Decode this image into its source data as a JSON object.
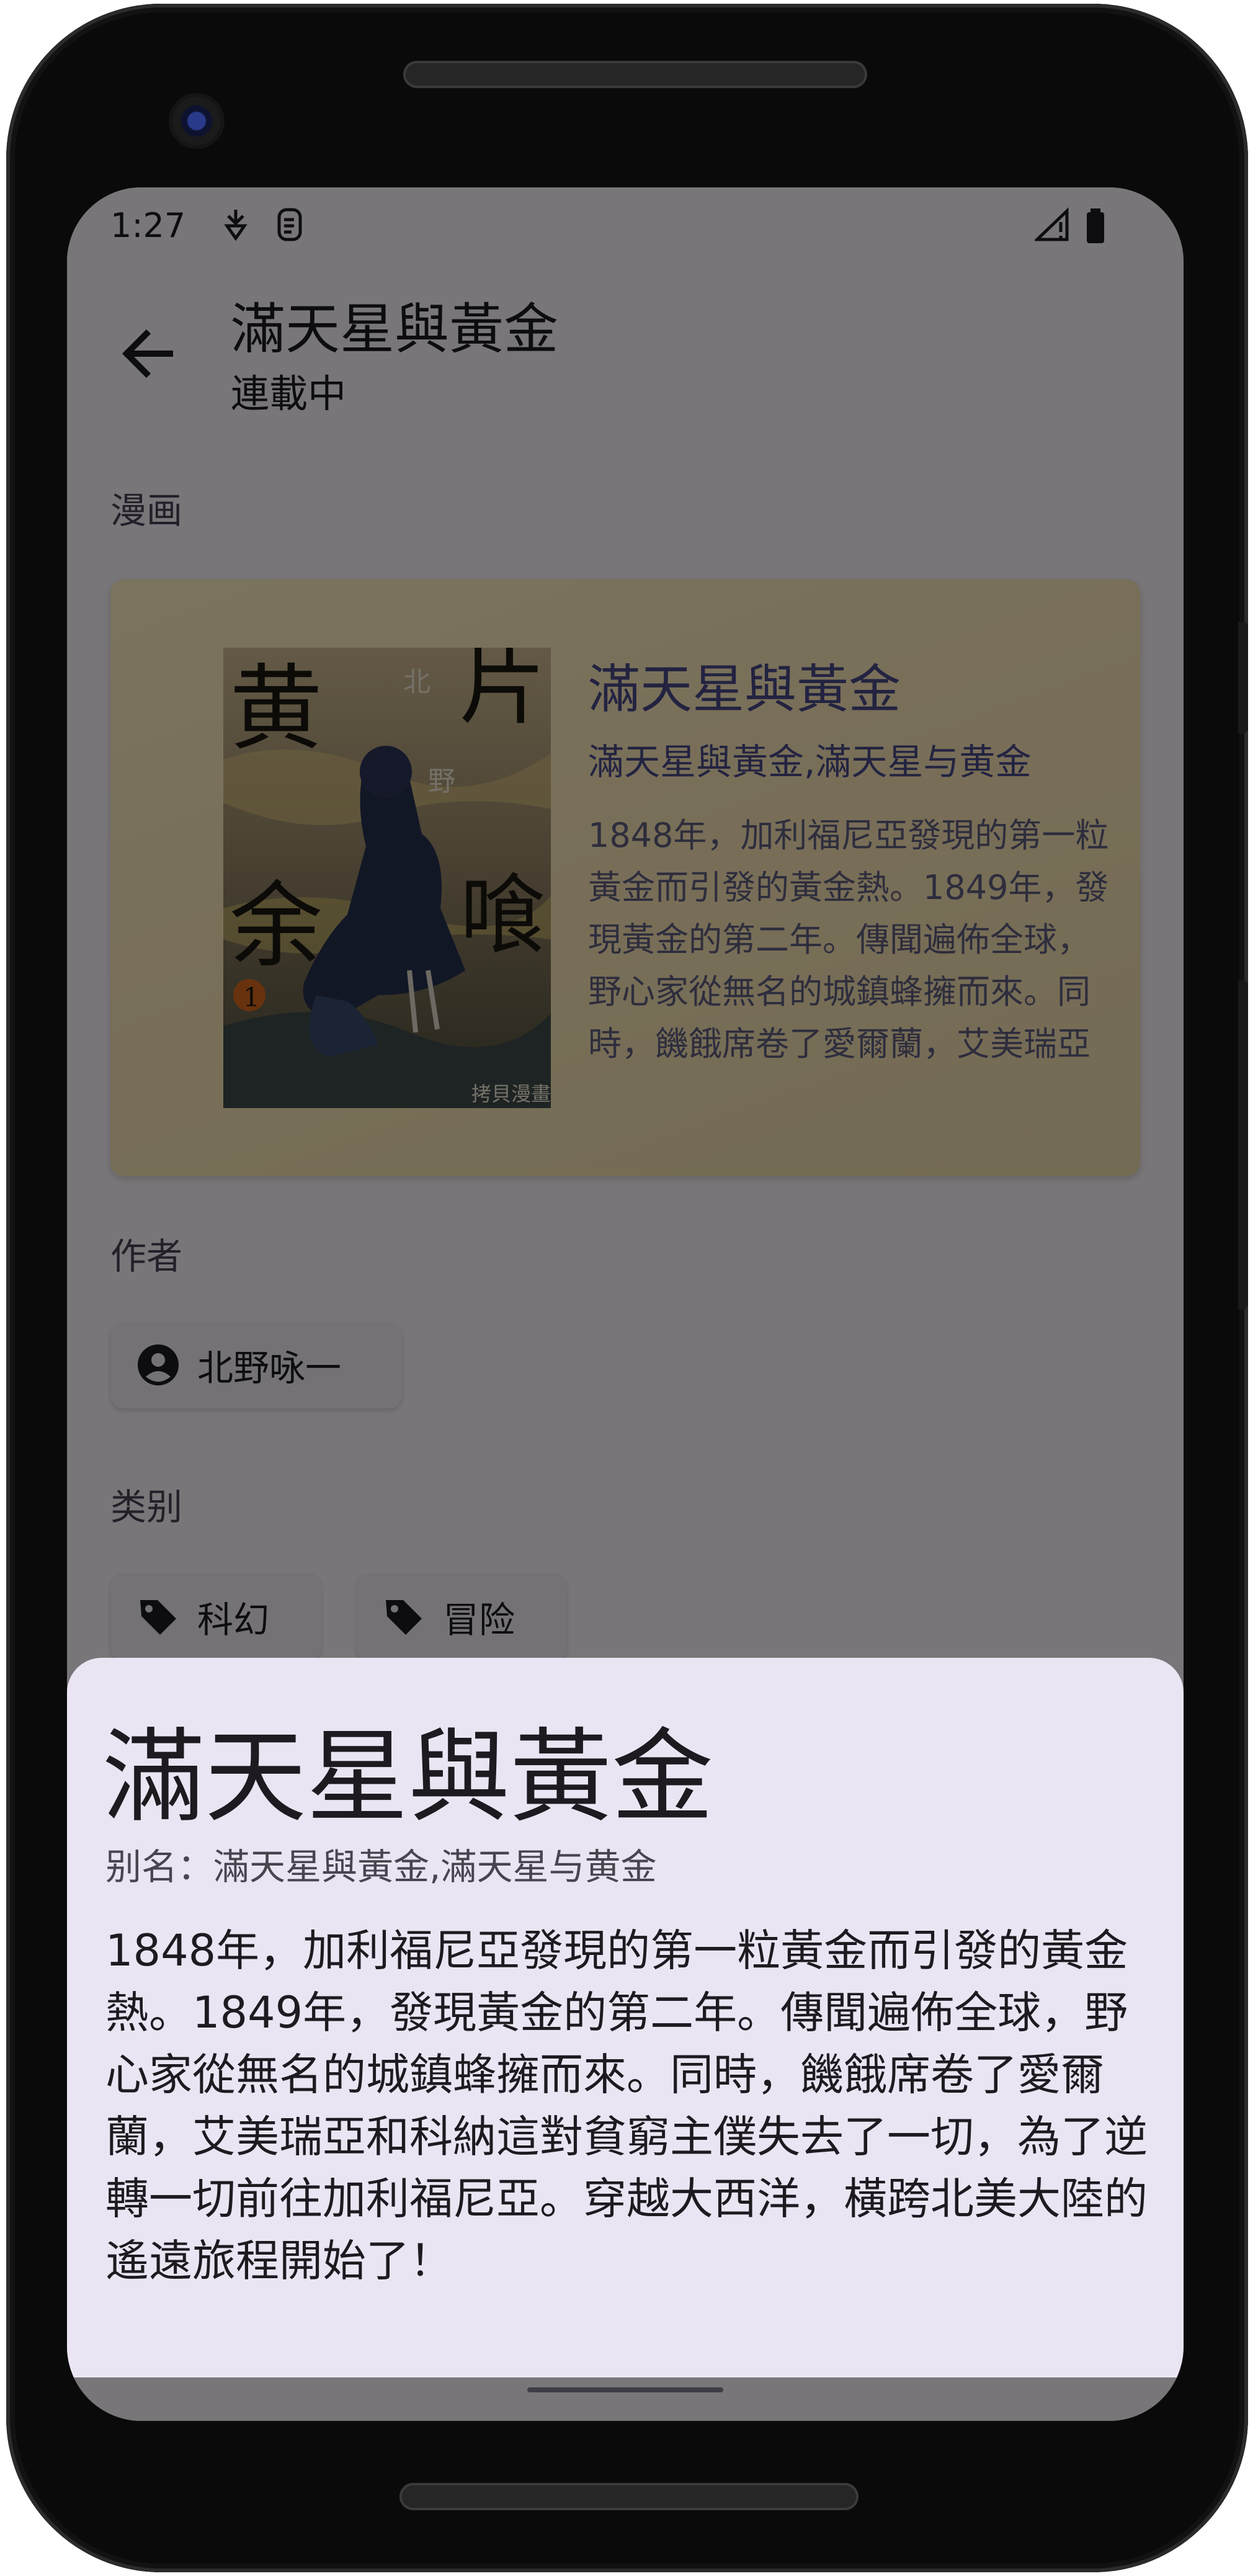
{
  "status_bar": {
    "time": "1:27"
  },
  "app_bar": {
    "title": "滿天星與黃金",
    "subtitle": "連載中"
  },
  "sections": {
    "comic_label": "漫画",
    "author_label": "作者",
    "category_label": "类别"
  },
  "card": {
    "title": "滿天星與黃金",
    "alias": "滿天星與黃金,滿天星与黄金",
    "description": "1848年，加利福尼亞發現的第一粒黃金而引發的黃金熱。1849年，發現黃金的第二年。傳聞遍佈全球，野心家從無名的城鎮蜂擁而來。同時，饑餓席卷了愛爾蘭，艾美瑞亞和科納這對貧窮主僕失去了一切，為了逆轉一切前往加利福尼亞。",
    "cover_chars": [
      "黄",
      "片",
      "余",
      "喰",
      "北",
      "野"
    ],
    "cover_volume": "1",
    "cover_publisher": "拷貝漫畫"
  },
  "author": {
    "name": "北野咏一"
  },
  "categories": [
    "科幻",
    "冒险"
  ],
  "sheet": {
    "title": "滿天星與黃金",
    "alias_label": "别名：",
    "alias_value": "滿天星與黃金,滿天星与黄金",
    "description": "1848年，加利福尼亞發現的第一粒黃金而引發的黃金熱。1849年，發現黃金的第二年。傳聞遍佈全球，野心家從無名的城鎮蜂擁而來。同時，饑餓席卷了愛爾蘭，艾美瑞亞和科納這對貧窮主僕失去了一切，為了逆轉一切前往加利福尼亞。穿越大西洋，橫跨北美大陸的遙遠旅程開始了！"
  },
  "icons": {
    "back": "arrow-back-icon",
    "author_chip": "account-circle-icon",
    "category_chip": "tag-icon",
    "status": [
      "nfc-icon",
      "storage-icon",
      "signal-icon",
      "battery-icon"
    ]
  },
  "colors": {
    "sheet_background": "#ebe5f3",
    "card_background": "#fbe7b8",
    "scrim": "rgba(0,0,0,0.52)"
  }
}
